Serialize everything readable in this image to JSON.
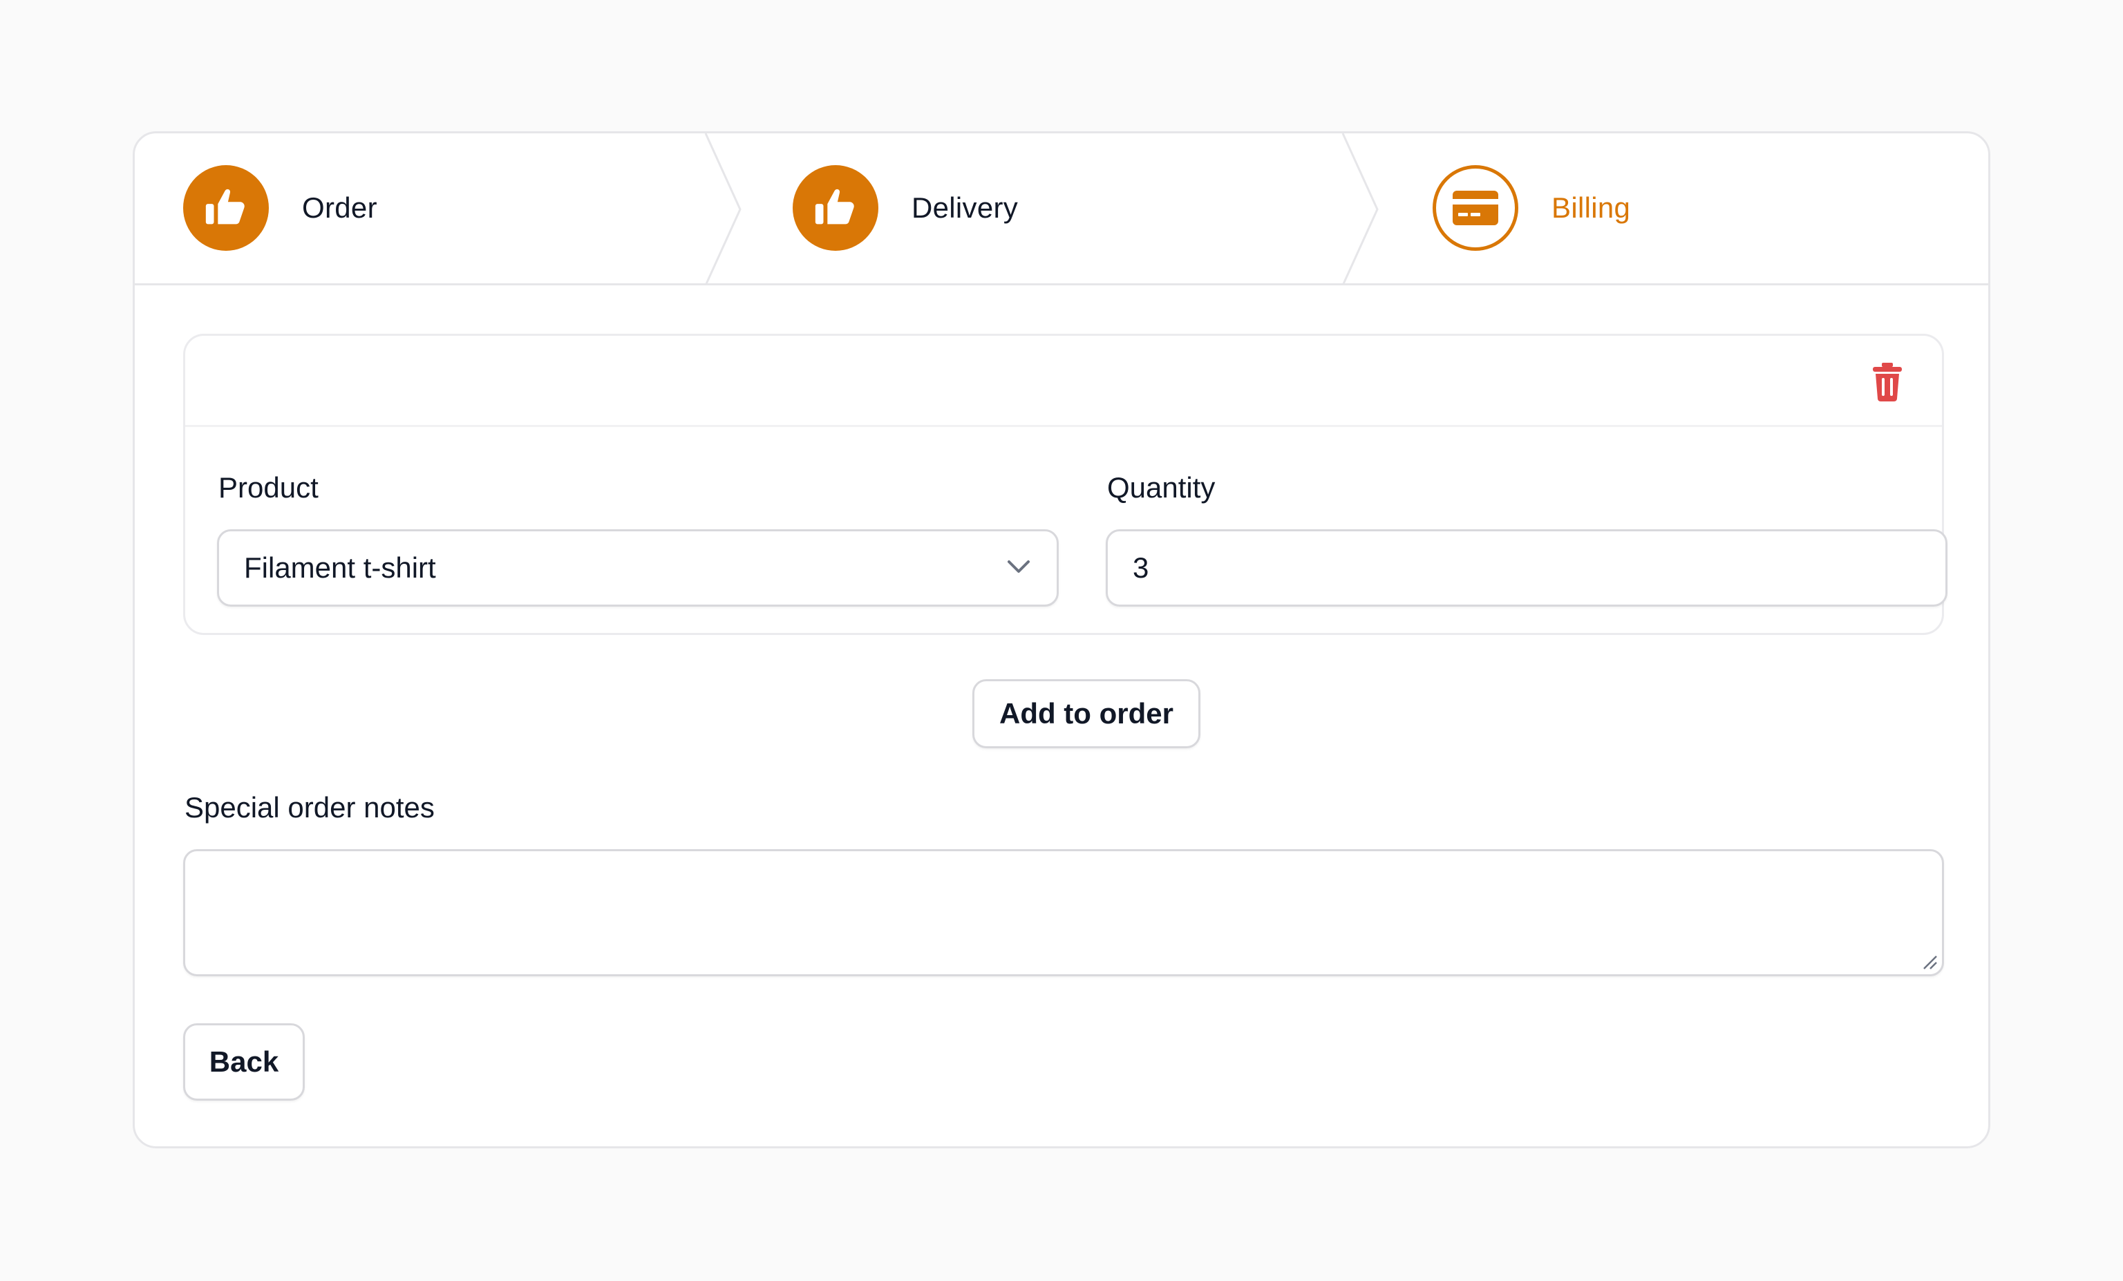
{
  "steps": [
    {
      "label": "Order",
      "status": "complete",
      "icon": "thumbs-up-icon"
    },
    {
      "label": "Delivery",
      "status": "complete",
      "icon": "thumbs-up-icon"
    },
    {
      "label": "Billing",
      "status": "current",
      "icon": "credit-card-icon"
    }
  ],
  "order_item": {
    "product": {
      "label": "Product",
      "value": "Filament t-shirt"
    },
    "quantity": {
      "label": "Quantity",
      "value": "3"
    },
    "delete_icon": "trash-icon"
  },
  "add_to_order_label": "Add to order",
  "notes": {
    "label": "Special order notes",
    "value": ""
  },
  "back_label": "Back",
  "colors": {
    "accent": "#d97706",
    "danger": "#e04848",
    "border": "#d8d8dc"
  }
}
